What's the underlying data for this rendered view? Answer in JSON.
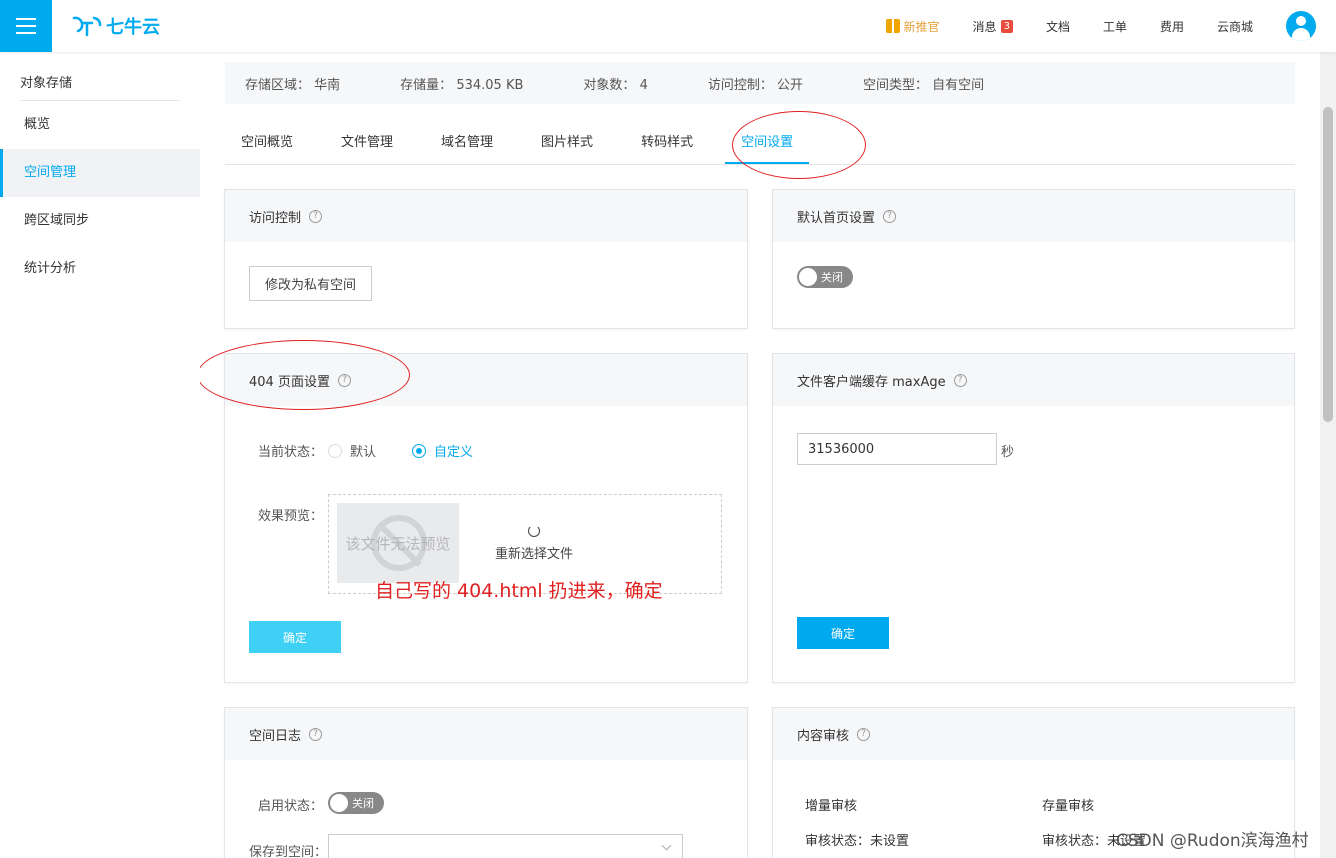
{
  "topbar": {
    "logo_text": "七牛云",
    "nav": [
      {
        "label": "新推官"
      },
      {
        "label": "消息",
        "badge": "3"
      },
      {
        "label": "文档"
      },
      {
        "label": "工单"
      },
      {
        "label": "费用"
      },
      {
        "label": "云商城"
      }
    ]
  },
  "sidebar": {
    "title": "对象存储",
    "items": [
      "概览",
      "空间管理",
      "跨区域同步",
      "统计分析"
    ],
    "active": "空间管理"
  },
  "info": {
    "region_label": "存储区域：",
    "region_value": "华南",
    "size_label": "存储量：",
    "size_value": "534.05 KB",
    "count_label": "对象数：",
    "count_value": "4",
    "access_label": "访问控制：",
    "access_value": "公开",
    "type_label": "空间类型：",
    "type_value": "自有空间"
  },
  "tabs": [
    "空间概览",
    "文件管理",
    "域名管理",
    "图片样式",
    "转码样式",
    "空间设置"
  ],
  "active_tab": "空间设置",
  "cards": {
    "access": {
      "title": "访问控制",
      "button": "修改为私有空间"
    },
    "homepage": {
      "title": "默认首页设置",
      "toggle": "关闭"
    },
    "page404": {
      "title": "404 页面设置",
      "status_label": "当前状态：",
      "opt_default": "默认",
      "opt_custom": "自定义",
      "preview_label": "效果预览：",
      "preview_text": "该文件无法预览",
      "reselect": "重新选择文件",
      "confirm": "确定"
    },
    "maxage": {
      "title": "文件客户端缓存 maxAge",
      "value": "31536000",
      "unit": "秒",
      "confirm": "确定"
    },
    "log": {
      "title": "空间日志",
      "status_label": "启用状态：",
      "toggle": "关闭",
      "save_label": "保存到空间："
    },
    "audit": {
      "title": "内容审核",
      "incr": "增量审核",
      "stock": "存量审核",
      "incr_status": "审核状态：未设置",
      "stock_status": "审核状态：未设置"
    }
  },
  "annotation": "自己写的 404.html 扔进来，确定",
  "watermark": "CSDN @Rudon滨海渔村",
  "colors": {
    "accent": "#00aaee",
    "annotation": "#e02020",
    "promo": "#e6a23c"
  }
}
